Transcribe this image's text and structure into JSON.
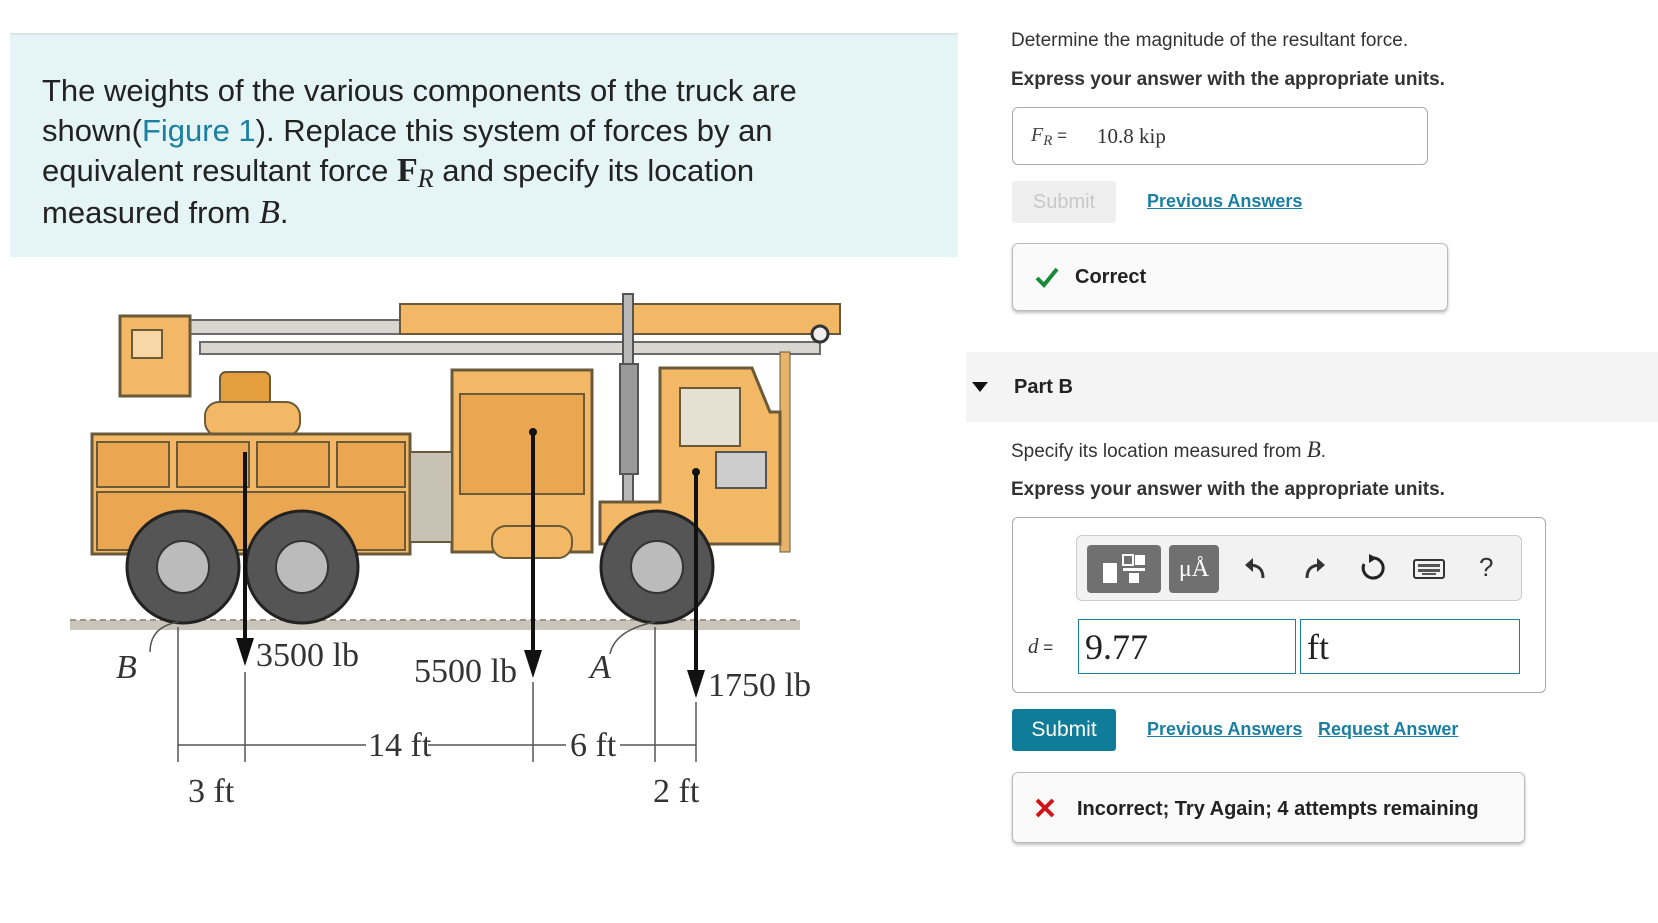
{
  "problem": {
    "text_before_link": "The weights of the various components of the truck are shown(",
    "figure_link": "Figure 1",
    "text_after_link": "). Replace this system of forces by an equivalent resultant force ",
    "force_symbol": "F",
    "force_subscript": "R",
    "text_tail": " and specify its location measured from ",
    "point": "B",
    "end": "."
  },
  "figure": {
    "loads": [
      "3500 lb",
      "5500 lb",
      "1750 lb"
    ],
    "points": [
      "B",
      "A"
    ],
    "dims_top": [
      "14 ft",
      "6 ft"
    ],
    "dims_bottom": [
      "3 ft",
      "2 ft"
    ]
  },
  "partA": {
    "prompt": "Determine the magnitude of the resultant force.",
    "instruction": "Express your answer with the appropriate units.",
    "answer_label_var": "F",
    "answer_label_sub": "R",
    "answer_label_eq": " =",
    "answer_value": "10.8 kip",
    "submit_label": "Submit",
    "previous_answers": "Previous Answers",
    "feedback": "Correct",
    "feedback_color": "#1a8a3a"
  },
  "partB": {
    "title": "Part B",
    "prompt_text": "Specify its location measured from ",
    "prompt_var": "B",
    "prompt_end": ".",
    "instruction": "Express your answer with the appropriate units.",
    "toolbar": {
      "units_label": "μÅ",
      "icons": [
        "templates-icon",
        "units-icon",
        "undo-icon",
        "redo-icon",
        "reset-icon",
        "keyboard-icon",
        "help-icon"
      ],
      "help_label": "?"
    },
    "var_label": "d",
    "var_eq": " =",
    "value": "9.77",
    "units": "ft",
    "submit_label": "Submit",
    "previous_answers": "Previous Answers",
    "request_answer": "Request Answer",
    "feedback": "Incorrect; Try Again; 4 attempts remaining",
    "feedback_color": "#d0151a"
  }
}
